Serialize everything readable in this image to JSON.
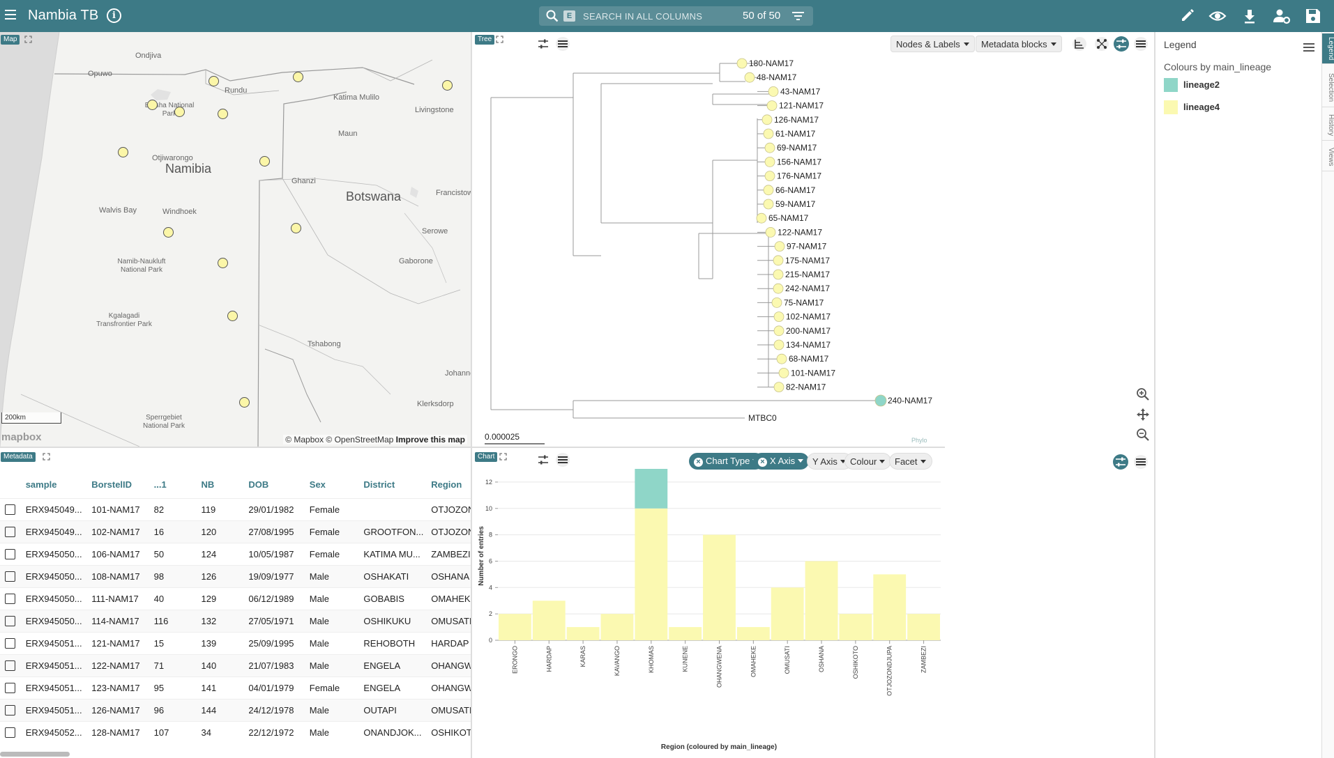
{
  "app": {
    "title": "Nambia TB"
  },
  "search": {
    "filter_badge": "E",
    "placeholder": "SEARCH IN ALL COLUMNS",
    "count": "50 of 50"
  },
  "toolbar": {
    "icons": [
      "pencil-icon",
      "eye-icon",
      "download-icon",
      "user-settings-icon",
      "save-icon"
    ]
  },
  "colors": {
    "header": "#3d7a86",
    "lineage2": "#8fd6c8",
    "lineage4": "#fbf9b1"
  },
  "map": {
    "tag": "Map",
    "labels": [
      {
        "text": "Ondjiva"
      },
      {
        "text": "Opuwo"
      },
      {
        "text": "Rundu"
      },
      {
        "text": "Katima Mulilo"
      },
      {
        "text": "Livingstone"
      },
      {
        "text": "Etosha National Park"
      },
      {
        "text": "Maun"
      },
      {
        "text": "Otjiwarongo"
      },
      {
        "text": "Francistown"
      },
      {
        "text": "Namibia"
      },
      {
        "text": "Ghanzi"
      },
      {
        "text": "Botswana"
      },
      {
        "text": "Serowe"
      },
      {
        "text": "Walvis Bay"
      },
      {
        "text": "Windhoek"
      },
      {
        "text": "Namib-Naukluft National Park"
      },
      {
        "text": "Gaborone"
      },
      {
        "text": "Kgalagadi Transfrontier Park"
      },
      {
        "text": "Tshabong"
      },
      {
        "text": "Johanne"
      },
      {
        "text": "Klerksdorp"
      },
      {
        "text": "Sperrgebiet National Park"
      }
    ],
    "scale": "200km",
    "logo": "mapbox",
    "attribution": "© Mapbox © OpenStreetMap",
    "improve": "Improve this map"
  },
  "tree": {
    "tag": "Tree",
    "nodes_labels": "Nodes & Labels",
    "metadata_blocks": "Metadata blocks",
    "leaves": [
      "180-NAM17",
      "48-NAM17",
      "43-NAM17",
      "121-NAM17",
      "126-NAM17",
      "61-NAM17",
      "69-NAM17",
      "156-NAM17",
      "176-NAM17",
      "66-NAM17",
      "59-NAM17",
      "65-NAM17",
      "122-NAM17",
      "97-NAM17",
      "175-NAM17",
      "215-NAM17",
      "242-NAM17",
      "75-NAM17",
      "102-NAM17",
      "200-NAM17",
      "134-NAM17",
      "68-NAM17",
      "101-NAM17",
      "82-NAM17",
      "240-NAM17"
    ],
    "outgroup": "MTBC0",
    "scale": "0.000025",
    "watermark": "Phylo"
  },
  "legend": {
    "title": "Legend",
    "subtitle": "Colours by main_lineage",
    "items": [
      {
        "label": "lineage2",
        "color": "#8fd6c8"
      },
      {
        "label": "lineage4",
        "color": "#fbf9b1"
      }
    ],
    "side_tabs": [
      "Legend",
      "Selection",
      "History",
      "Views"
    ]
  },
  "metadata": {
    "tag": "Metadata",
    "columns": [
      "sample",
      "BorstelID",
      "...1",
      "NB",
      "DOB",
      "Sex",
      "District",
      "Region"
    ],
    "rows": [
      [
        "ERX945049...",
        "101-NAM17",
        "82",
        "119",
        "29/01/1982",
        "Female",
        "",
        "OTJOZONDJUPA"
      ],
      [
        "ERX945049...",
        "102-NAM17",
        "16",
        "120",
        "27/08/1995",
        "Female",
        "GROOTFON...",
        "OTJOZONDJUPA"
      ],
      [
        "ERX945050...",
        "106-NAM17",
        "50",
        "124",
        "10/05/1987",
        "Female",
        "KATIMA MU...",
        "ZAMBEZI"
      ],
      [
        "ERX945050...",
        "108-NAM17",
        "98",
        "126",
        "19/09/1977",
        "Male",
        "OSHAKATI",
        "OSHANA"
      ],
      [
        "ERX945050...",
        "111-NAM17",
        "40",
        "129",
        "06/12/1989",
        "Male",
        "GOBABIS",
        "OMAHEKE"
      ],
      [
        "ERX945050...",
        "114-NAM17",
        "116",
        "132",
        "27/05/1971",
        "Male",
        "OSHIKUKU",
        "OMUSATI"
      ],
      [
        "ERX945051...",
        "121-NAM17",
        "15",
        "139",
        "25/09/1995",
        "Male",
        "REHOBOTH",
        "HARDAP"
      ],
      [
        "ERX945051...",
        "122-NAM17",
        "71",
        "140",
        "21/07/1983",
        "Male",
        "ENGELA",
        "OHANGWENA"
      ],
      [
        "ERX945051...",
        "123-NAM17",
        "95",
        "141",
        "04/01/1979",
        "Female",
        "ENGELA",
        "OHANGWENA"
      ],
      [
        "ERX945051...",
        "126-NAM17",
        "96",
        "144",
        "24/12/1978",
        "Male",
        "OUTAPI",
        "OMUSATI"
      ],
      [
        "ERX945052...",
        "128-NAM17",
        "107",
        "34",
        "22/12/1972",
        "Male",
        "ONANDJOK...",
        "OSHIKOTO"
      ]
    ]
  },
  "chart_panel": {
    "tag": "Chart",
    "controls": {
      "chart_type": "Chart Type",
      "x_axis": "X Axis",
      "y_axis": "Y Axis",
      "colour": "Colour",
      "facet": "Facet"
    }
  },
  "chart_data": {
    "type": "bar",
    "stacked": true,
    "xlabel": "Region (coloured by main_lineage)",
    "ylabel": "Number of entries",
    "ylim": [
      0,
      13
    ],
    "yticks": [
      0,
      2,
      4,
      6,
      8,
      10,
      12
    ],
    "grid": true,
    "categories": [
      "ERONGO",
      "HARDAP",
      "KARAS",
      "KAVANGO",
      "KHOMAS",
      "KUNENE",
      "OHANGWENA",
      "OMAHEKE",
      "OMUSATI",
      "OSHANA",
      "OSHIKOTO",
      "OTJOZONDJUPA",
      "ZAMBEZI"
    ],
    "series": [
      {
        "name": "lineage4",
        "color": "#fbf9b1",
        "values": [
          2,
          3,
          1,
          2,
          10,
          1,
          8,
          1,
          4,
          6,
          2,
          5,
          2
        ]
      },
      {
        "name": "lineage2",
        "color": "#8fd6c8",
        "values": [
          0,
          0,
          0,
          0,
          3,
          0,
          0,
          0,
          0,
          0,
          0,
          0,
          0
        ]
      }
    ]
  }
}
